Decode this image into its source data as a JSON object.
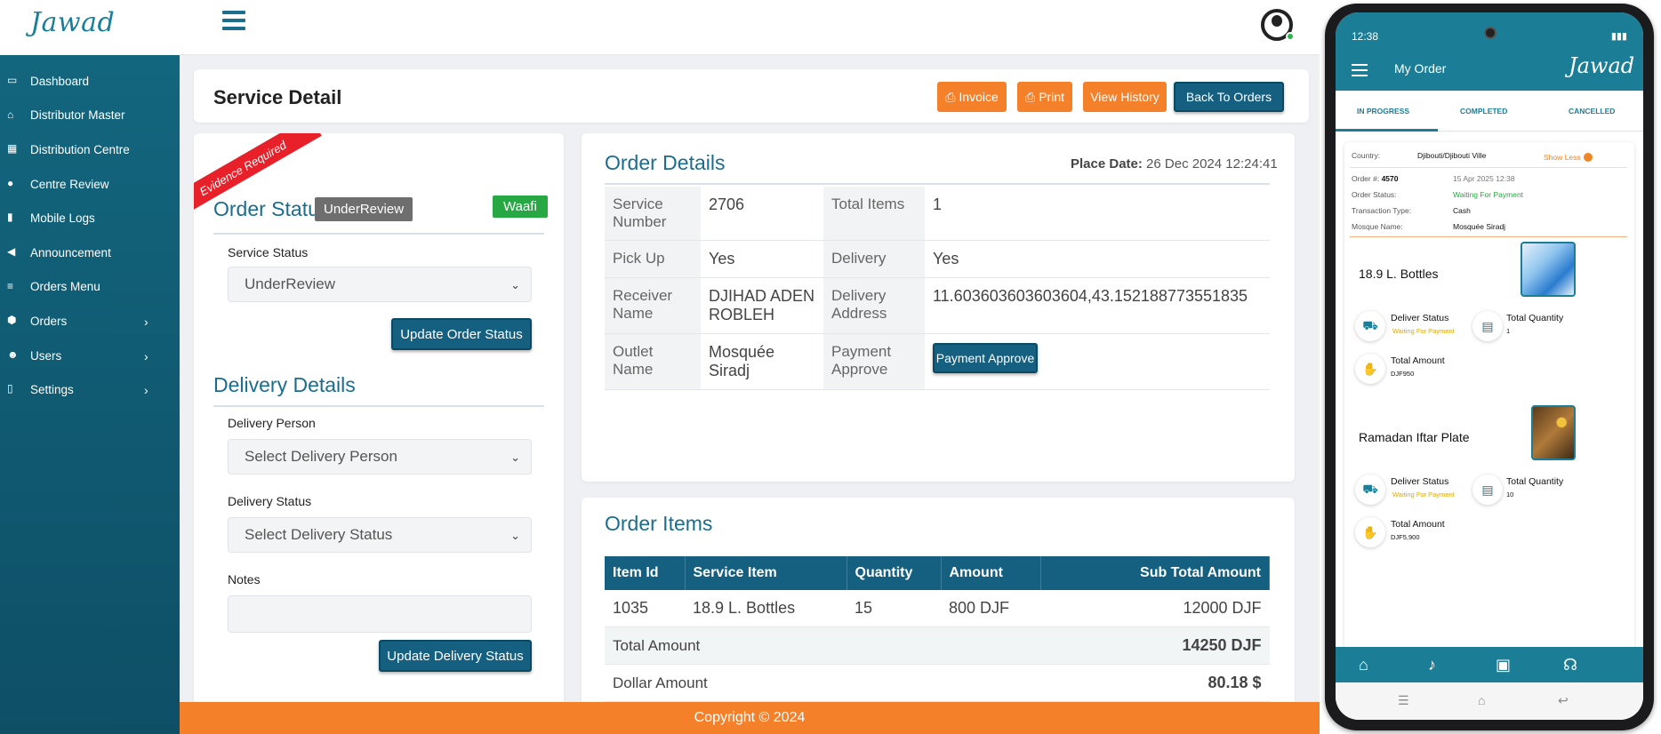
{
  "app": {
    "logo_text": "Jawad",
    "user_online": true
  },
  "sidebar": {
    "items": [
      {
        "label": "Dashboard",
        "icon": "laptop-icon"
      },
      {
        "label": "Distributor Master",
        "icon": "store-icon"
      },
      {
        "label": "Distribution Centre",
        "icon": "grid-icon"
      },
      {
        "label": "Centre Review",
        "icon": "comments-icon"
      },
      {
        "label": "Mobile Logs",
        "icon": "bar-chart-icon"
      },
      {
        "label": "Announcement",
        "icon": "megaphone-icon"
      },
      {
        "label": "Orders Menu",
        "icon": "list-icon"
      },
      {
        "label": "Orders",
        "icon": "cube-icon",
        "has_submenu": true
      },
      {
        "label": "Users",
        "icon": "users-icon",
        "has_submenu": true
      },
      {
        "label": "Settings",
        "icon": "file-icon",
        "has_submenu": true
      }
    ]
  },
  "header": {
    "title": "Service Detail",
    "buttons": {
      "invoice": "Invoice",
      "print": "Print",
      "view_history": "View History",
      "back": "Back To Orders"
    }
  },
  "order_status": {
    "ribbon": "Evidence Required",
    "title": "Order Status",
    "status_badge": "UnderReview",
    "payment_badge": "Waafi",
    "service_status_label": "Service Status",
    "service_status_value": "UnderReview",
    "update_button": "Update Order Status"
  },
  "delivery": {
    "title": "Delivery Details",
    "person_label": "Delivery Person",
    "person_placeholder": "Select Delivery Person",
    "status_label": "Delivery Status",
    "status_placeholder": "Select Delivery Status",
    "notes_label": "Notes",
    "notes_value": "",
    "update_button": "Update Delivery Status"
  },
  "order_details": {
    "title": "Order Details",
    "place_date_label": "Place Date:",
    "place_date_value": "26 Dec 2024 12:24:41",
    "service_number_label": "Service Number",
    "service_number": "2706",
    "total_items_label": "Total Items",
    "total_items": "1",
    "pickup_label": "Pick Up",
    "pickup": "Yes",
    "delivery_label": "Delivery",
    "delivery": "Yes",
    "receiver_label": "Receiver Name",
    "receiver": "DJIHAD ADEN ROBLEH",
    "delivery_address_label": "Delivery Address",
    "delivery_address": "11.603603603603604,43.152188773551835",
    "outlet_label": "Outlet Name",
    "outlet": "Mosquée Siradj",
    "payment_label": "Payment Approve",
    "payment_button": "Payment Approve"
  },
  "order_items": {
    "title": "Order Items",
    "columns": [
      "Item Id",
      "Service Item",
      "Quantity",
      "Amount",
      "Sub Total Amount"
    ],
    "rows": [
      {
        "id": "1035",
        "item": "18.9 L. Bottles",
        "qty": "15",
        "amount": "800 DJF",
        "subtotal": "12000 DJF"
      }
    ],
    "total_label": "Total Amount",
    "total_value": "14250 DJF",
    "dollar_label": "Dollar Amount",
    "dollar_value": "80.18 $"
  },
  "footer": {
    "text": "Copyright © 2024"
  },
  "phone": {
    "time": "12:38",
    "app_title": "My Order",
    "logo": "Jawad",
    "tabs": [
      "IN PROGRESS",
      "COMPLETED",
      "CANCELLED"
    ],
    "country_label": "Country:",
    "country": "Djibouti/Djibouti Ville",
    "show_less": "Show Less",
    "order_no_label": "Order #:",
    "order_no": "4570",
    "order_date": "15 Apr 2025 12:38",
    "order_status_label": "Order Status:",
    "order_status": "Waiting For Payment",
    "txn_label": "Transaction Type:",
    "txn": "Cash",
    "mosque_label": "Mosque Name:",
    "mosque": "Mosquée Siradj",
    "items": [
      {
        "name": "18.9 L. Bottles",
        "deliver_status_label": "Deliver Status",
        "deliver_status": "Waiting For Payment",
        "qty_label": "Total Quantity",
        "qty": "1",
        "amount_label": "Total Amount",
        "amount": "DJF950"
      },
      {
        "name": "Ramadan Iftar Plate",
        "deliver_status_label": "Deliver Status",
        "deliver_status": "Waiting For Payment",
        "qty_label": "Total Quantity",
        "qty": "10",
        "amount_label": "Total Amount",
        "amount": "DJF5,900"
      }
    ]
  },
  "colors": {
    "primary": "#155f80",
    "sidebar": "#12667e",
    "accent": "#f5802a",
    "success": "#28a745",
    "ribbon": "#e8202a"
  }
}
